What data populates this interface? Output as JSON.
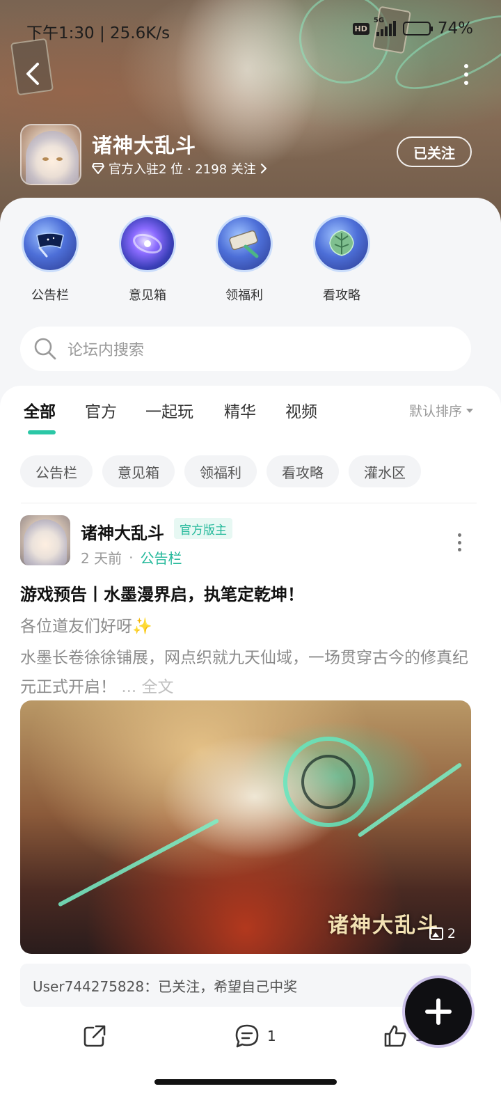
{
  "status_bar": {
    "time": "下午1:30 | 25.6K/s",
    "network_badge": "HD",
    "network_type": "5G",
    "battery_level": 0.74,
    "battery": "74%"
  },
  "header": {
    "game_name": "诸神大乱斗",
    "meta": "官方入驻2 位 · 2198 关注",
    "follow_label": "已关注"
  },
  "quick_entries": [
    {
      "label": "公告栏",
      "icon": "scroll-banner-icon"
    },
    {
      "label": "意见箱",
      "icon": "galaxy-icon"
    },
    {
      "label": "领福利",
      "icon": "gift-scroll-icon"
    },
    {
      "label": "看攻略",
      "icon": "guide-leaf-icon"
    }
  ],
  "search": {
    "placeholder": "论坛内搜索"
  },
  "tabs": [
    {
      "label": "全部",
      "active": true
    },
    {
      "label": "官方",
      "active": false
    },
    {
      "label": "一起玩",
      "active": false
    },
    {
      "label": "精华",
      "active": false
    },
    {
      "label": "视频",
      "active": false
    }
  ],
  "sort_label": "默认排序",
  "chips": [
    "公告栏",
    "意见箱",
    "领福利",
    "看攻略",
    "灌水区"
  ],
  "post": {
    "author": "诸神大乱斗",
    "badge": "官方版主",
    "time": "2 天前",
    "separator": "·",
    "category": "公告栏",
    "title": "游戏预告丨水墨漫界启，执笔定乾坤！",
    "line1": "各位道友们好呀✨",
    "line2": "水墨长卷徐徐铺展，网点织就九天仙域，一场贯穿古今的修真纪元正式开启！",
    "more_label": "... 全文",
    "image_logo": "诸神大乱斗",
    "image_count": "2",
    "comment_preview": "User744275828：已关注，希望自己中奖",
    "comments": "1",
    "likes": "10"
  },
  "colors": {
    "accent": "#2bc7a6",
    "badge_text": "#23b89a",
    "fab": "#0f0f12"
  }
}
